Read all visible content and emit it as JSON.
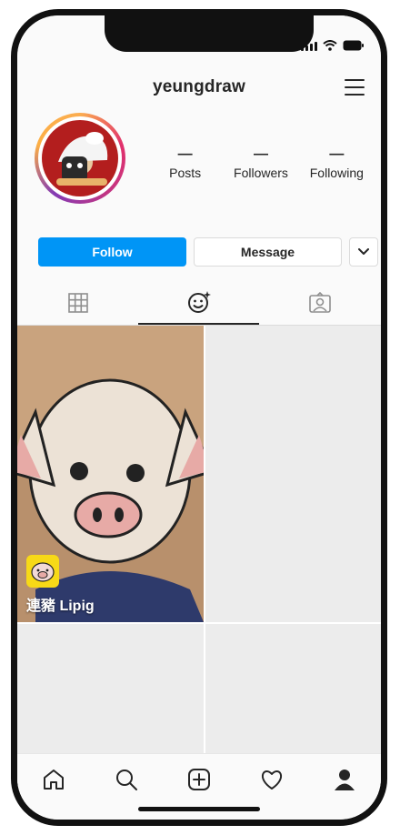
{
  "status_bar": {
    "signal_icon": "cellular-signal-icon",
    "wifi_icon": "wifi-icon",
    "battery_icon": "battery-icon"
  },
  "header": {
    "username": "yeungdraw",
    "menu_icon": "hamburger-menu-icon"
  },
  "profile": {
    "avatar_icon": "profile-avatar",
    "stats": [
      {
        "count": "—",
        "label": "Posts"
      },
      {
        "count": "—",
        "label": "Followers"
      },
      {
        "count": "—",
        "label": "Following"
      }
    ]
  },
  "actions": {
    "follow_label": "Follow",
    "message_label": "Message",
    "more_icon": "chevron-down-icon"
  },
  "tabs": [
    {
      "icon": "grid-icon",
      "active": false
    },
    {
      "icon": "effects-icon",
      "active": true
    },
    {
      "icon": "tagged-icon",
      "active": false
    }
  ],
  "posts": [
    {
      "label": "連豬 Lipig",
      "effect_icon": "lipig-effect-icon"
    }
  ],
  "bottom_nav": [
    {
      "icon": "home-icon"
    },
    {
      "icon": "search-icon"
    },
    {
      "icon": "create-post-icon"
    },
    {
      "icon": "activity-heart-icon"
    },
    {
      "icon": "profile-icon"
    }
  ],
  "colors": {
    "accent": "#0095f6",
    "text": "#262626",
    "border": "#dbdbdb",
    "background": "#fafafa"
  }
}
